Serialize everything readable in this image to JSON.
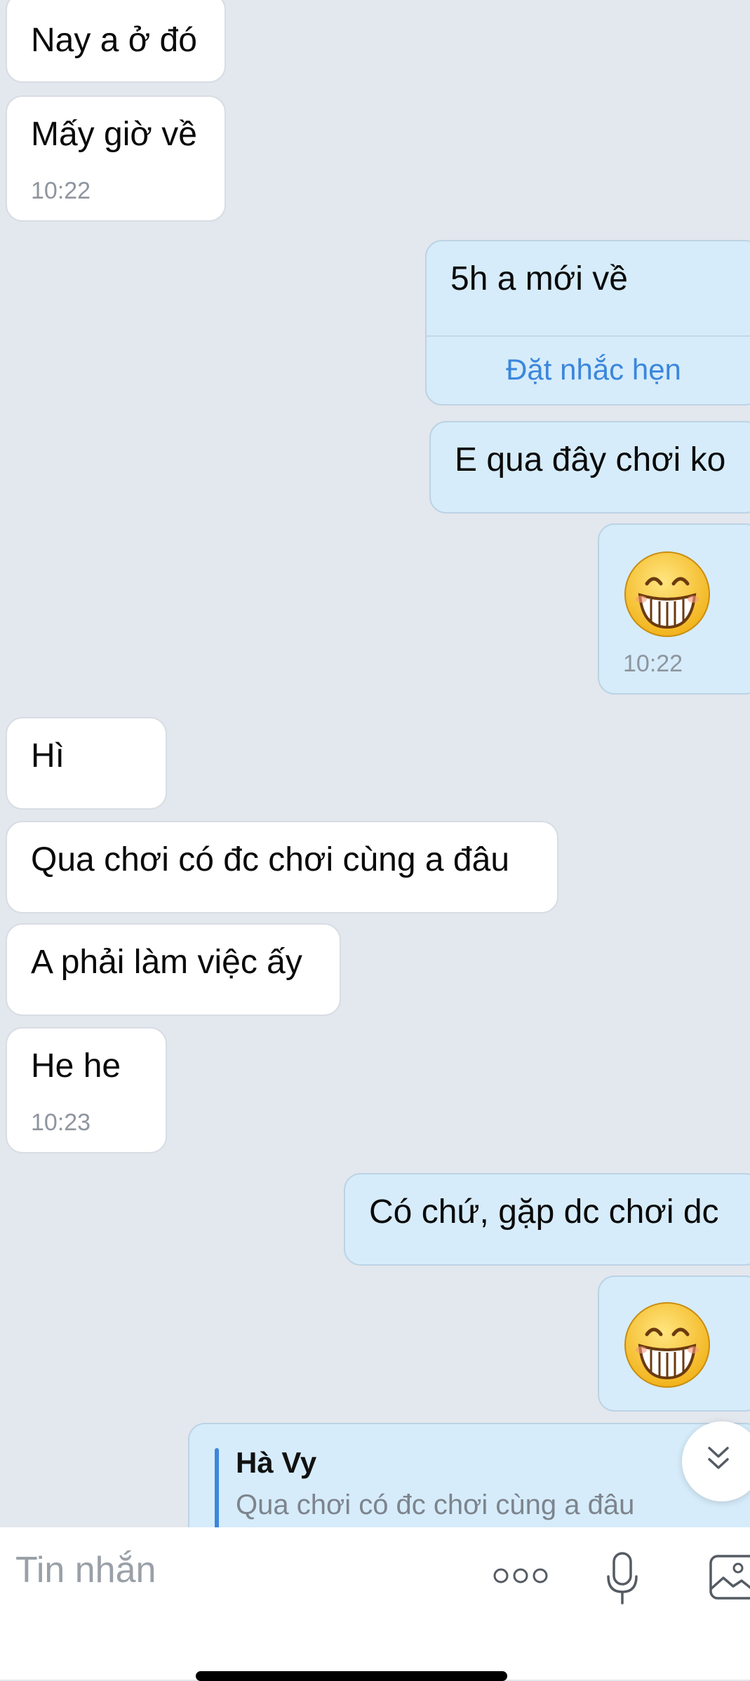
{
  "messages": [
    {
      "side": "received",
      "text": "Nay a ở đó"
    },
    {
      "side": "received",
      "text": "Mấy giờ về",
      "time": "10:22"
    },
    {
      "side": "sent",
      "text": "5h a mới về",
      "action": "Đặt nhắc hẹn"
    },
    {
      "side": "sent",
      "text": "E qua đây chơi ko"
    },
    {
      "side": "sent",
      "emoji": "grinning-face-icon",
      "time": "10:22"
    },
    {
      "side": "received",
      "text": "Hì"
    },
    {
      "side": "received",
      "text": "Qua chơi có đc chơi cùng a đâu"
    },
    {
      "side": "received",
      "text": "A phải làm việc ấy"
    },
    {
      "side": "received",
      "text": "He he",
      "time": "10:23"
    },
    {
      "side": "sent",
      "text": "Có chứ, gặp dc chơi dc"
    },
    {
      "side": "sent",
      "emoji": "grinning-face-icon"
    },
    {
      "side": "sent",
      "reply_to": {
        "name": "Hà Vy",
        "text": "Qua chơi có đc chơi cùng a đâu"
      }
    }
  ],
  "composer": {
    "placeholder": "Tin nhắn",
    "icons": [
      "more-options-icon",
      "microphone-icon",
      "image-gallery-icon"
    ]
  },
  "colors": {
    "background": "#e3e7ee",
    "received_bubble": "#ffffff",
    "sent_bubble": "#d6ecfa",
    "accent": "#3b86dc"
  }
}
